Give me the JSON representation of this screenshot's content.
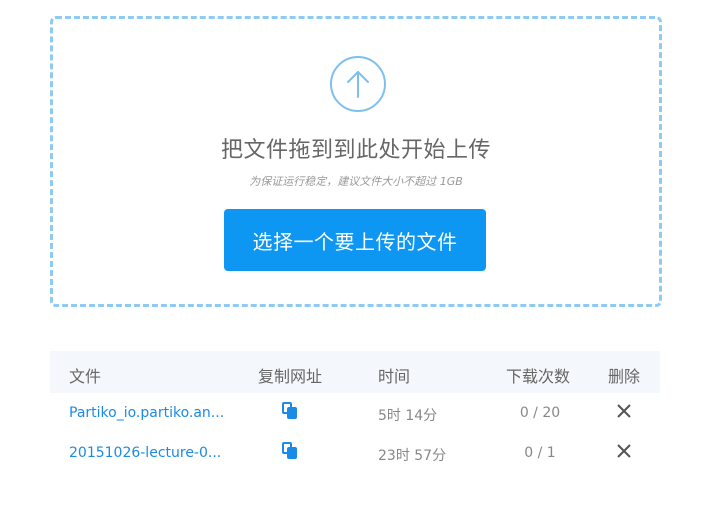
{
  "dropzone": {
    "title": "把文件拖到到此处开始上传",
    "hint": "为保证运行稳定，建议文件大小不超过 1GB",
    "choose_button": "选择一个要上传的文件",
    "icon": "upload-arrow-circle-icon"
  },
  "table": {
    "headers": {
      "file": "文件",
      "copy_url": "复制网址",
      "time": "时间",
      "downloads": "下载次数",
      "delete": "删除"
    },
    "rows": [
      {
        "name": "Partiko_io.partiko.an...",
        "time": "5时 14分",
        "downloads": "0 / 20"
      },
      {
        "name": "20151026-lecture-0...",
        "time": "23时 57分",
        "downloads": "0 / 1"
      }
    ]
  },
  "colors": {
    "accent": "#0d96f2",
    "dashed_border": "#8fcaf3",
    "link": "#1a8be6",
    "header_bg": "#f4f8fc"
  }
}
